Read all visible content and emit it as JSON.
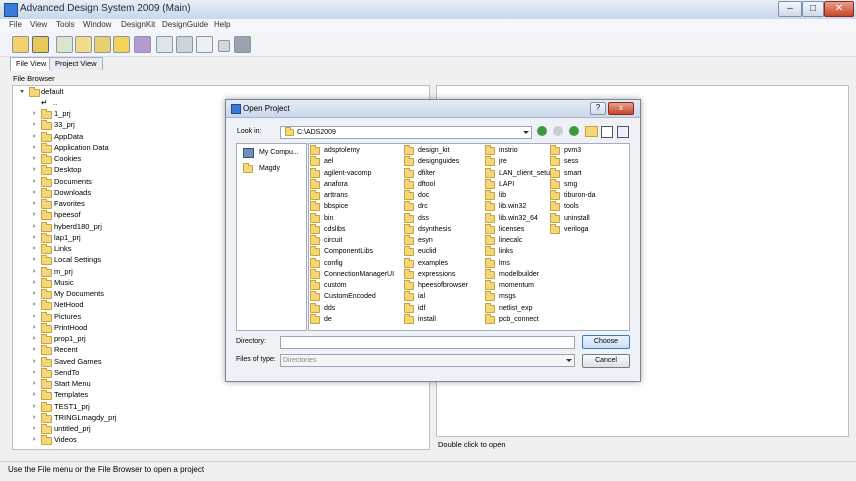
{
  "window": {
    "title": "Advanced Design System 2009 (Main)"
  },
  "menu": [
    "File",
    "View",
    "Tools",
    "Window",
    "DesignKit",
    "DesignGuide",
    "Help"
  ],
  "tabs": [
    "File View",
    "Project View"
  ],
  "file_browser": {
    "label": "File Browser",
    "root": "default",
    "up": "..",
    "items": [
      "1_prj",
      "33_prj",
      "AppData",
      "Application Data",
      "Cookies",
      "Desktop",
      "Documents",
      "Downloads",
      "Favorites",
      "hpeesof",
      "hyberd180_prj",
      "lap1_prj",
      "Links",
      "Local Settings",
      "m_prj",
      "Music",
      "My Documents",
      "NetHood",
      "Pictures",
      "PrintHood",
      "prop1_prj",
      "Recent",
      "Saved Games",
      "SendTo",
      "Start Menu",
      "Templates",
      "TEST1_prj",
      "TRINGLmagdy_prj",
      "untitled_prj",
      "Videos"
    ]
  },
  "right_pane": {
    "status": "Double click to open"
  },
  "status_bar": "Use the File menu or the File Browser to open a project",
  "dialog": {
    "title": "Open Project",
    "help_label": "?",
    "close_label": "x",
    "look_in_label": "Look in:",
    "look_in_value": "C:\\ADS2009",
    "places": [
      "My Compu...",
      "Magdy"
    ],
    "columns": [
      [
        "adsptolemy",
        "ael",
        "agilent-vacomp",
        "anafora",
        "arttrans",
        "bbspice",
        "bin",
        "cdslibs",
        "circuit",
        "ComponentLibs",
        "config",
        "ConnectionManagerUI",
        "custom",
        "CustomEncoded",
        "dds",
        "de"
      ],
      [
        "design_kit",
        "designguides",
        "dfilter",
        "dftool",
        "doc",
        "drc",
        "dss",
        "dsynthesis",
        "esyn",
        "euclid",
        "examples",
        "expressions",
        "hpeesofbrowser",
        "ial",
        "idf",
        "install"
      ],
      [
        "instrio",
        "jre",
        "LAN_client_setup",
        "LAPI",
        "lib",
        "lib.win32",
        "lib.win32_64",
        "licenses",
        "linecalc",
        "links",
        "lms",
        "modelbuilder",
        "momentum",
        "msgs",
        "netlist_exp",
        "pcb_connect"
      ],
      [
        "pvm3",
        "sess",
        "smart",
        "smg",
        "tiburon-da",
        "tools",
        "uninstall",
        "veriloga"
      ]
    ],
    "directory_label": "Directory:",
    "directory_value": "",
    "files_of_type_label": "Files of type:",
    "files_of_type_value": "Directories",
    "choose_label": "Choose",
    "cancel_label": "Cancel"
  },
  "colors": {
    "folder": "#f5d77a",
    "accent": "#3a79c4",
    "close": "#c6452b"
  }
}
